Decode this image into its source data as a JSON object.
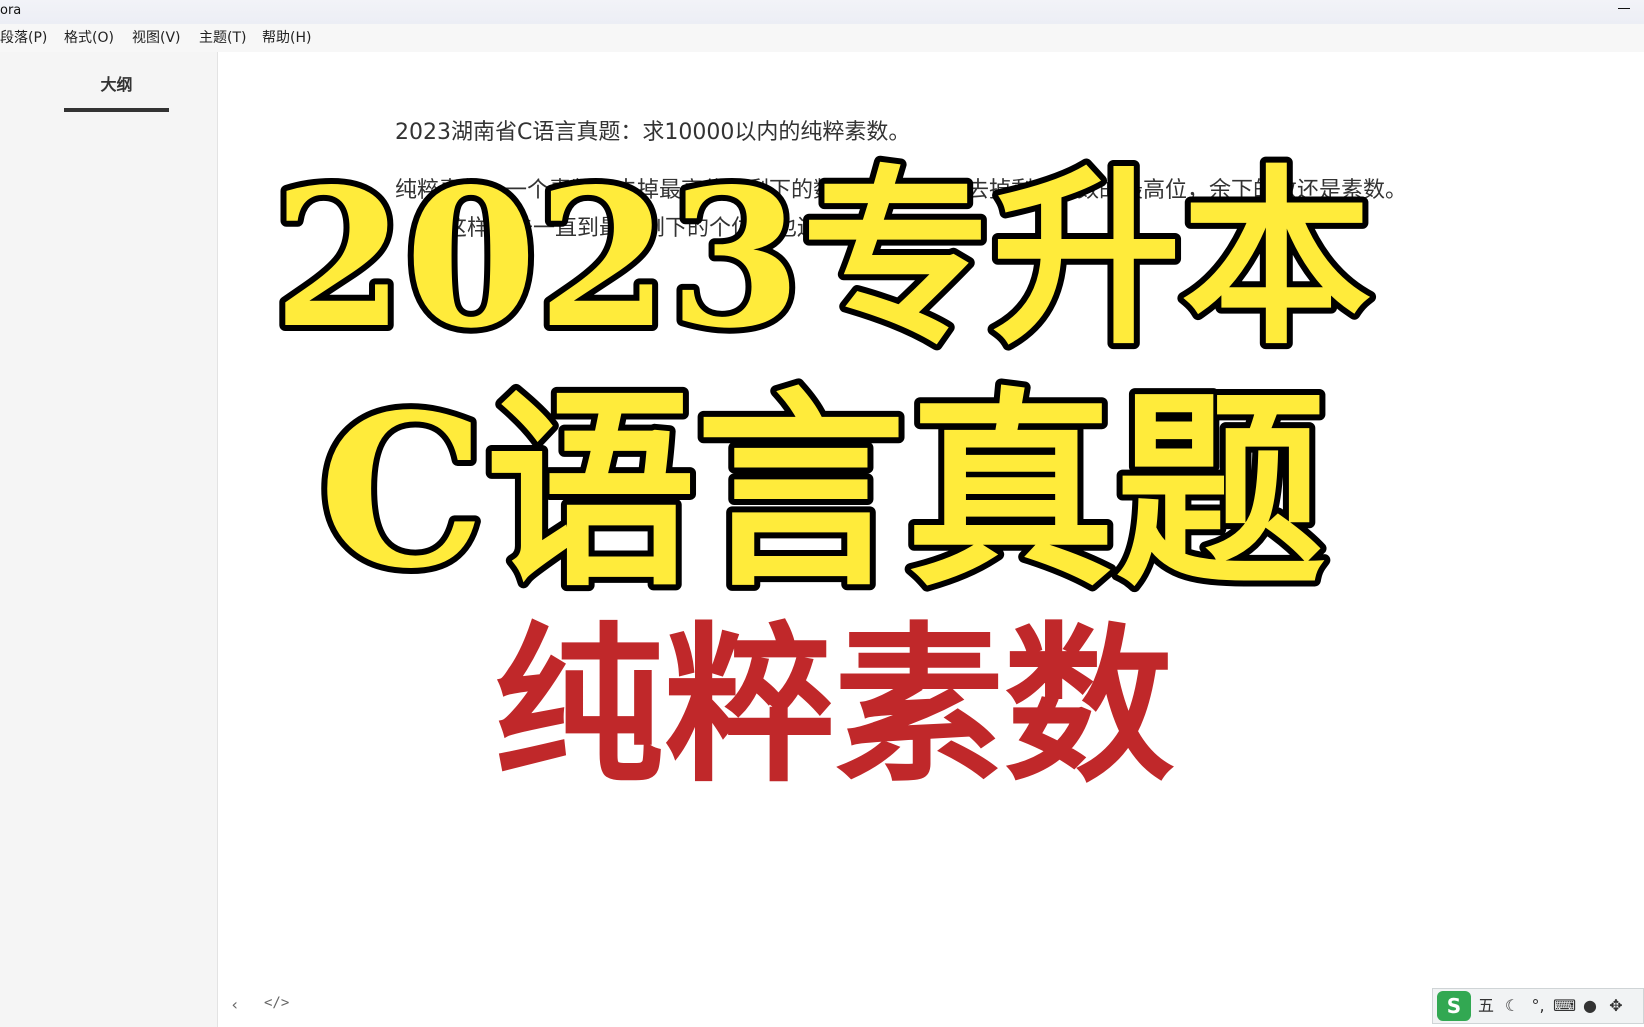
{
  "titlebar": {
    "app_name": "ora"
  },
  "menu": {
    "items": [
      "段落(P)",
      "格式(O)",
      "视图(V)",
      "主题(T)",
      "帮助(H)"
    ]
  },
  "sidebar": {
    "outline_tab": "大纲"
  },
  "footer": {
    "prev_icon": "chevron-left-icon",
    "source_icon": "code-icon"
  },
  "document": {
    "line1": "2023湖南省C语言真题：求10000以内的纯粹素数。",
    "line2": "纯粹素数：一个素数，去掉最高位，剩下的数仍是素数；再去掉剩下的数的最高位，余下的数还是素数。",
    "line3": "这样下去一直到最后剩下的个位数也还是素数。"
  },
  "thumbnail_overlay": {
    "title1": "2023专升本",
    "title2": "C语言真题",
    "title3": "纯粹素数",
    "colors": {
      "yellow": "#ffeb3b",
      "outline": "#000000",
      "red": "#c0282a"
    }
  },
  "ime": {
    "logo": "S",
    "mode": "五",
    "icons": [
      "moon-icon",
      "punctuation-icon",
      "keyboard-icon",
      "user-icon",
      "grid-icon"
    ]
  }
}
